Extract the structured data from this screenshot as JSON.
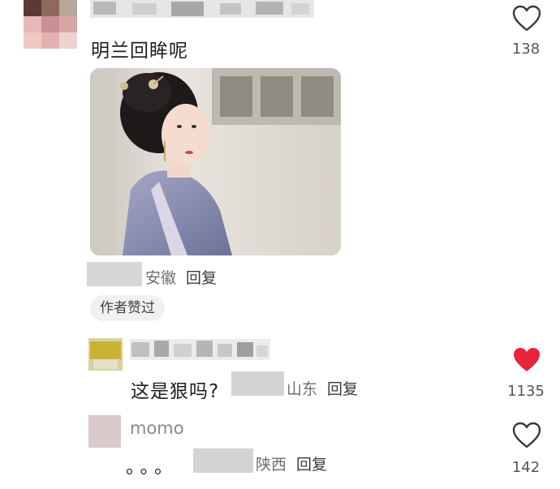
{
  "comments": [
    {
      "text": "明兰回眸呢",
      "likes": "138",
      "meta": {
        "location": "安徽",
        "reply": "回复"
      },
      "badge": "作者赞过"
    },
    {
      "text": "这是狠吗?",
      "likes": "1135",
      "liked": true,
      "meta": {
        "location": "山东",
        "reply": "回复"
      }
    },
    {
      "username": "momo",
      "text": "。。。",
      "likes": "142",
      "meta": {
        "location": "陕西",
        "reply": "回复"
      }
    }
  ],
  "colors": {
    "like_active": "#e8233a",
    "meta_gray": "#6e6e6e"
  },
  "icons": {
    "like": "heart-icon"
  }
}
